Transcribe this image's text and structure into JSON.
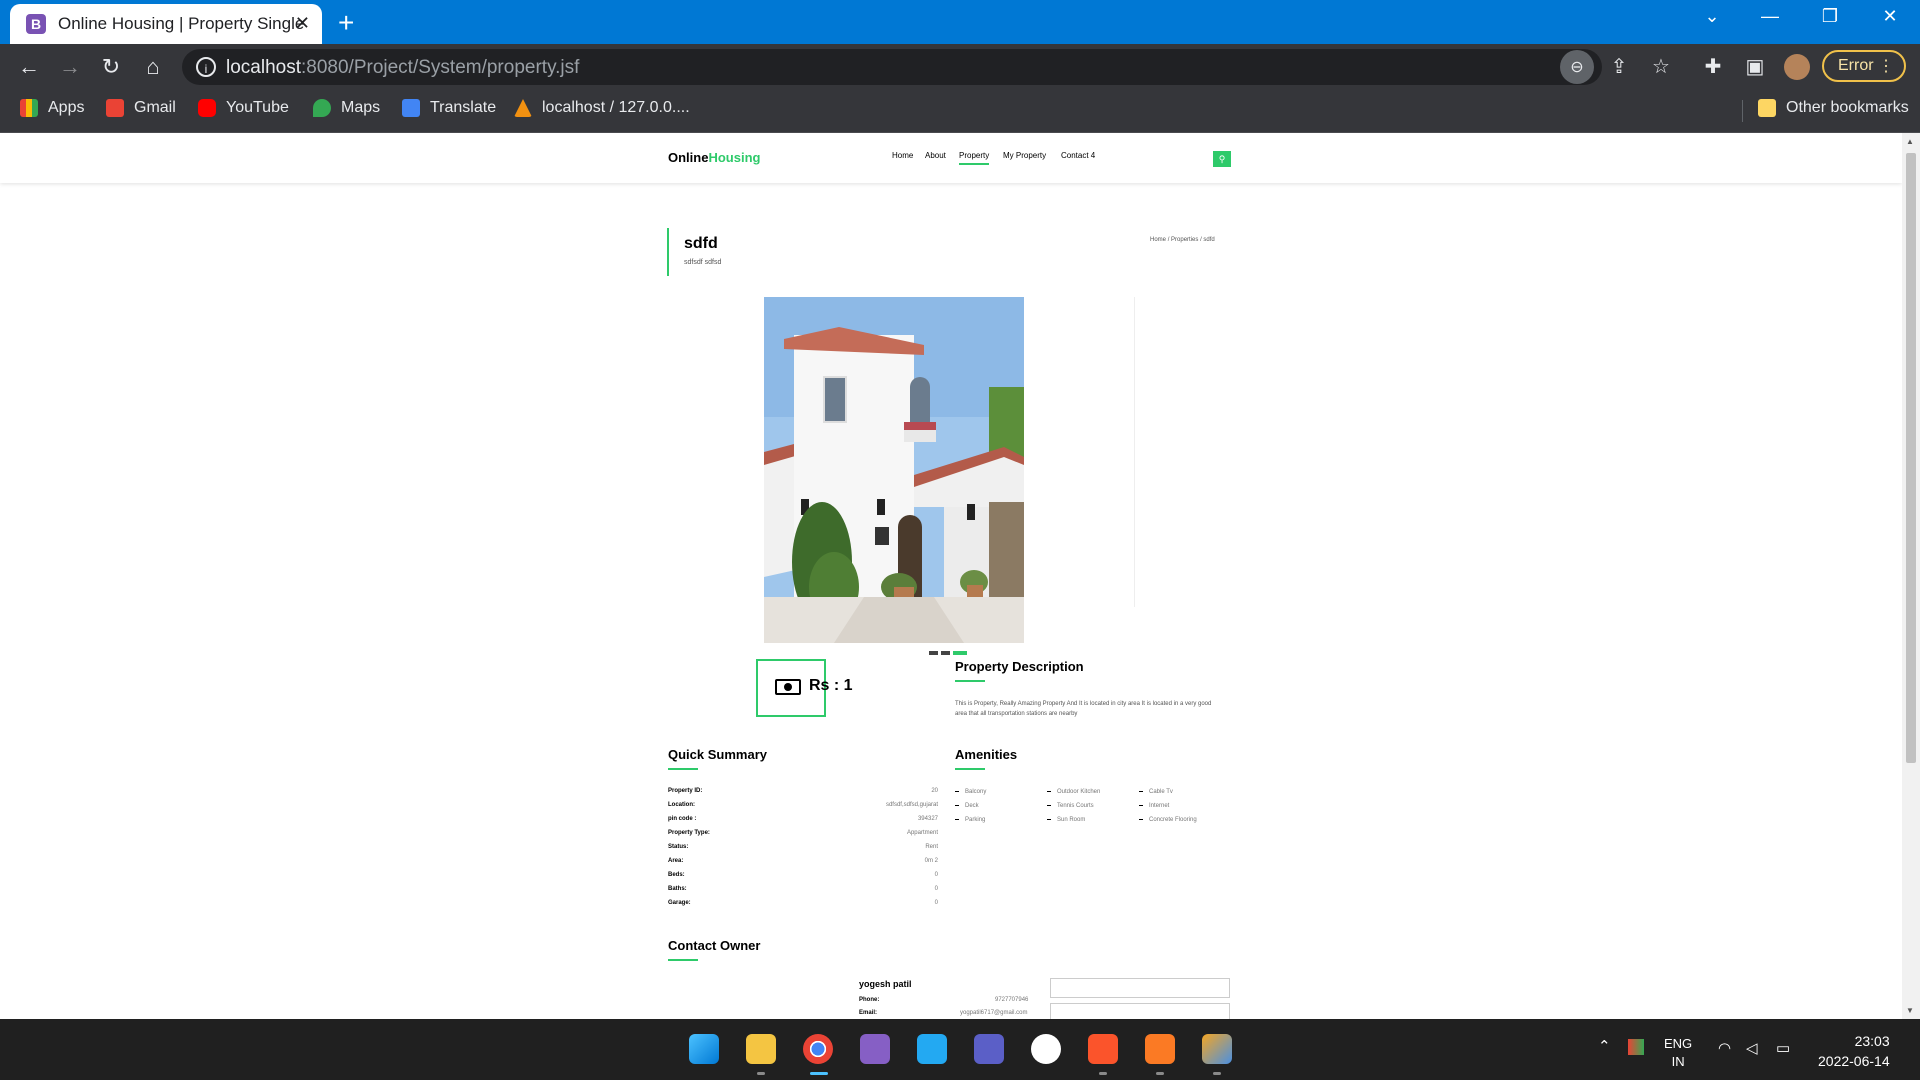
{
  "browser": {
    "tab_title": "Online Housing | Property Single",
    "tab_favicon_letter": "B",
    "url_host": "localhost",
    "url_path": ":8080/Project/System/property.jsf",
    "error_label": "Error",
    "bookmarks": [
      "Apps",
      "Gmail",
      "YouTube",
      "Maps",
      "Translate",
      "localhost / 127.0.0....",
      "Other bookmarks"
    ]
  },
  "site": {
    "brand_part1": "Online",
    "brand_part2": "Housing",
    "brand_accent": "#2eca6a",
    "nav": [
      "Home",
      "About",
      "Property",
      "My Property",
      "Contact 4"
    ],
    "active_nav": "Property"
  },
  "property": {
    "title": "sdfd",
    "address": "sdfsdf sdfsd",
    "breadcrumb": [
      "Home",
      "/",
      "Properties",
      "/",
      "sdfd"
    ],
    "price": "Rs : 1",
    "description_title": "Property Description",
    "description": "This is Property, Really Amazing Property And It is located in city area It is located in a very good area that all transportation stations are nearby",
    "summary_title": "Quick Summary",
    "summary": [
      {
        "label": "Property ID:",
        "value": "20"
      },
      {
        "label": "Location:",
        "value": "sdfsdf,sdfsd,gujarat"
      },
      {
        "label": "pin code :",
        "value": "394327"
      },
      {
        "label": "Property Type:",
        "value": "Appartment"
      },
      {
        "label": "Status:",
        "value": "Rent"
      },
      {
        "label": "Area:",
        "value": "0m 2"
      },
      {
        "label": "Beds:",
        "value": "0"
      },
      {
        "label": "Baths:",
        "value": "0"
      },
      {
        "label": "Garage:",
        "value": "0"
      }
    ],
    "amenities_title": "Amenities",
    "amenities": [
      "Balcony",
      "Outdoor Kitchen",
      "Cable Tv",
      "Deck",
      "Tennis Courts",
      "Internet",
      "Parking",
      "Sun Room",
      "Concrete Flooring"
    ]
  },
  "owner": {
    "section_title": "Contact Owner",
    "name": "yogesh patil",
    "phone_label": "Phone:",
    "phone": "9727707946",
    "email_label": "Email:",
    "email": "yogpatil6717@gmail.com"
  },
  "taskbar": {
    "lang_line1": "ENG",
    "lang_line2": "IN",
    "time": "23:03",
    "date": "2022-06-14"
  }
}
